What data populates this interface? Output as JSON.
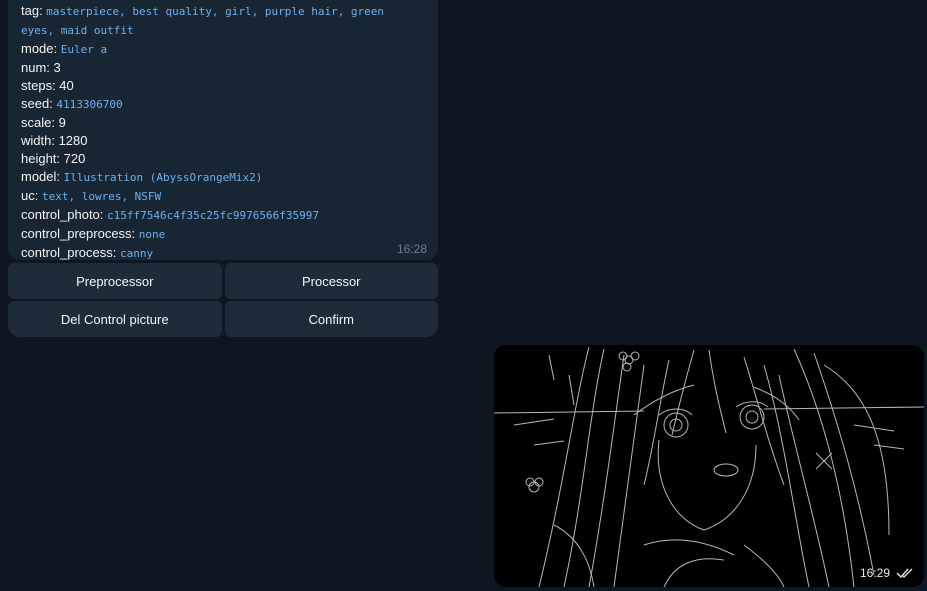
{
  "message": {
    "lines": [
      {
        "key": "tag:",
        "value": "masterpiece, best quality, girl, purple hair, green",
        "mono": true
      },
      {
        "key": "",
        "value": "eyes, maid outfit",
        "mono": true
      },
      {
        "key": "mode:",
        "value": "Euler a",
        "mono": true
      },
      {
        "key": "num:",
        "value": "3",
        "mono": false
      },
      {
        "key": "steps:",
        "value": "40",
        "mono": false
      },
      {
        "key": "seed:",
        "value": "4113306700",
        "mono": true
      },
      {
        "key": "scale:",
        "value": "9",
        "mono": false
      },
      {
        "key": "width:",
        "value": "1280",
        "mono": false
      },
      {
        "key": "height:",
        "value": "720",
        "mono": false
      },
      {
        "key": "model:",
        "value": "Illustration (AbyssOrangeMix2)",
        "mono": true
      },
      {
        "key": "uc:",
        "value": "text, lowres, NSFW",
        "mono": true
      },
      {
        "key": "control_photo:",
        "value": "c15ff7546c4f35c25fc9976566f35997",
        "mono": true
      },
      {
        "key": "control_preprocess:",
        "value": "none",
        "mono": true
      },
      {
        "key": "control_process:",
        "value": "canny",
        "mono": true
      }
    ],
    "time": "16:28"
  },
  "keyboard": {
    "preprocessor_label": "Preprocessor",
    "processor_label": "Processor",
    "del_control_label": "Del Control picture",
    "confirm_label": "Confirm"
  },
  "photo": {
    "time": "16:29",
    "status_icon": "double-check-icon"
  }
}
